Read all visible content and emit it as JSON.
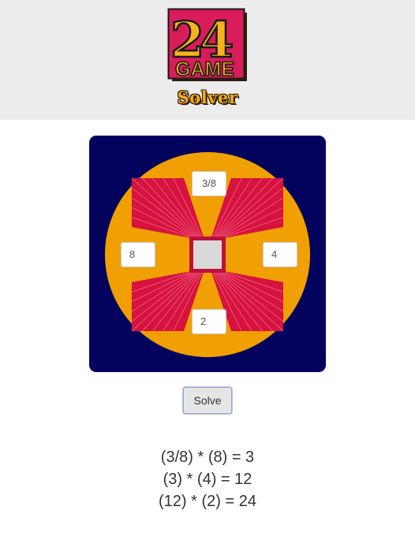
{
  "header": {
    "logo": {
      "number": "24",
      "word": "GAME",
      "icon": "24-game-logo"
    },
    "subtitle": "Solver",
    "background": "#ececec"
  },
  "board": {
    "background": "#03035e",
    "disc_color": "#f0a003",
    "ray_color": "#d6123f",
    "inputs": {
      "top": "3/8",
      "left": "8",
      "right": "4",
      "bottom": "2"
    }
  },
  "solve_button": {
    "label": "Solve"
  },
  "solution": {
    "lines": [
      "(3/8) * (8) = 3",
      "(3) * (4) = 12",
      "(12) * (2) = 24"
    ]
  }
}
